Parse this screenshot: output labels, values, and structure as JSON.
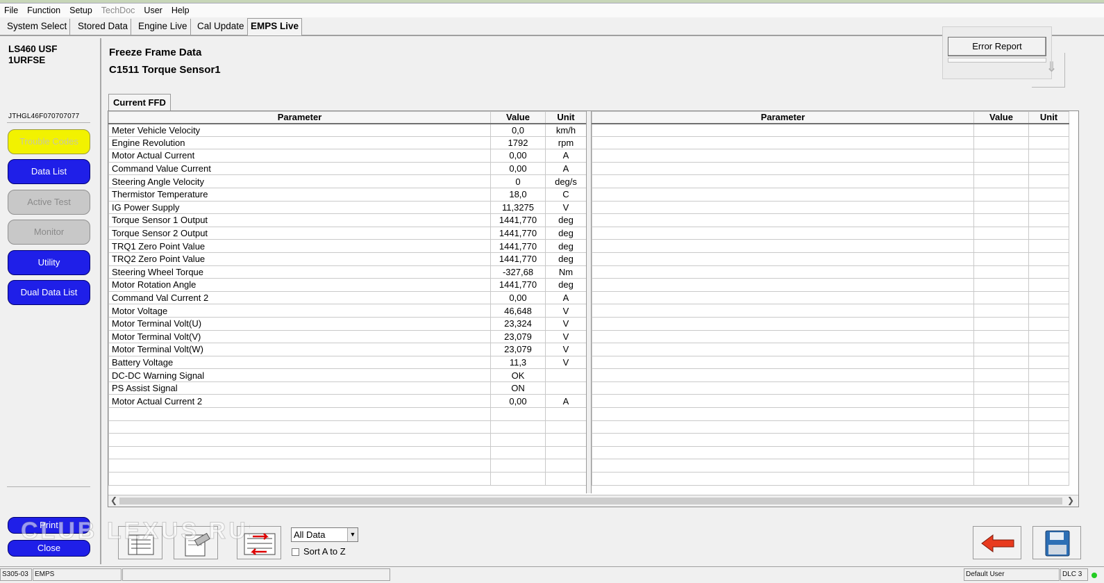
{
  "menu": [
    "File",
    "Function",
    "Setup",
    "TechDoc",
    "User",
    "Help"
  ],
  "tabs": [
    "System Select",
    "Stored Data",
    "Engine Live",
    "Cal Update",
    "EMPS Live"
  ],
  "sidebar": {
    "vehicle_line1": "LS460 USF",
    "vehicle_line2": "1URFSE",
    "vin": "JTHGL46F070707077",
    "buttons": [
      "Trouble Codes",
      "Data List",
      "Active Test",
      "Monitor",
      "Utility",
      "Dual Data List"
    ],
    "print": "Print",
    "close": "Close"
  },
  "main": {
    "title": "Freeze Frame Data",
    "subtitle": "C1511 Torque Sensor1",
    "error_report": "Error Report",
    "tab": "Current FFD",
    "headers": [
      "Parameter",
      "Value",
      "Unit"
    ],
    "rows": [
      [
        "Meter Vehicle Velocity",
        "0,0",
        "km/h"
      ],
      [
        "Engine Revolution",
        "1792",
        "rpm"
      ],
      [
        "Motor Actual Current",
        "0,00",
        "A"
      ],
      [
        "Command Value Current",
        "0,00",
        "A"
      ],
      [
        "Steering Angle Velocity",
        "0",
        "deg/s"
      ],
      [
        "Thermistor Temperature",
        "18,0",
        "C"
      ],
      [
        "IG Power Supply",
        "11,3275",
        "V"
      ],
      [
        "Torque Sensor 1 Output",
        "1441,770",
        "deg"
      ],
      [
        "Torque Sensor 2 Output",
        "1441,770",
        "deg"
      ],
      [
        "TRQ1 Zero Point Value",
        "1441,770",
        "deg"
      ],
      [
        "TRQ2 Zero Point Value",
        "1441,770",
        "deg"
      ],
      [
        "Steering Wheel Torque",
        "-327,68",
        "Nm"
      ],
      [
        "Motor Rotation Angle",
        "1441,770",
        "deg"
      ],
      [
        "Command Val Current 2",
        "0,00",
        "A"
      ],
      [
        "Motor Voltage",
        "46,648",
        "V"
      ],
      [
        "Motor Terminal Volt(U)",
        "23,324",
        "V"
      ],
      [
        "Motor Terminal Volt(V)",
        "23,079",
        "V"
      ],
      [
        "Motor Terminal Volt(W)",
        "23,079",
        "V"
      ],
      [
        "Battery Voltage",
        "11,3",
        "V"
      ],
      [
        "DC-DC Warning Signal",
        "OK",
        ""
      ],
      [
        "PS Assist Signal",
        "ON",
        ""
      ],
      [
        "Motor Actual Current 2",
        "0,00",
        "A"
      ]
    ],
    "filter_value": "All Data",
    "sort_label": "Sort A to Z"
  },
  "watermark": "CLUB LEXUS RUSSIA",
  "status": {
    "code": "S305-03",
    "system": "EMPS",
    "user": "Default User",
    "dlc": "DLC 3"
  }
}
